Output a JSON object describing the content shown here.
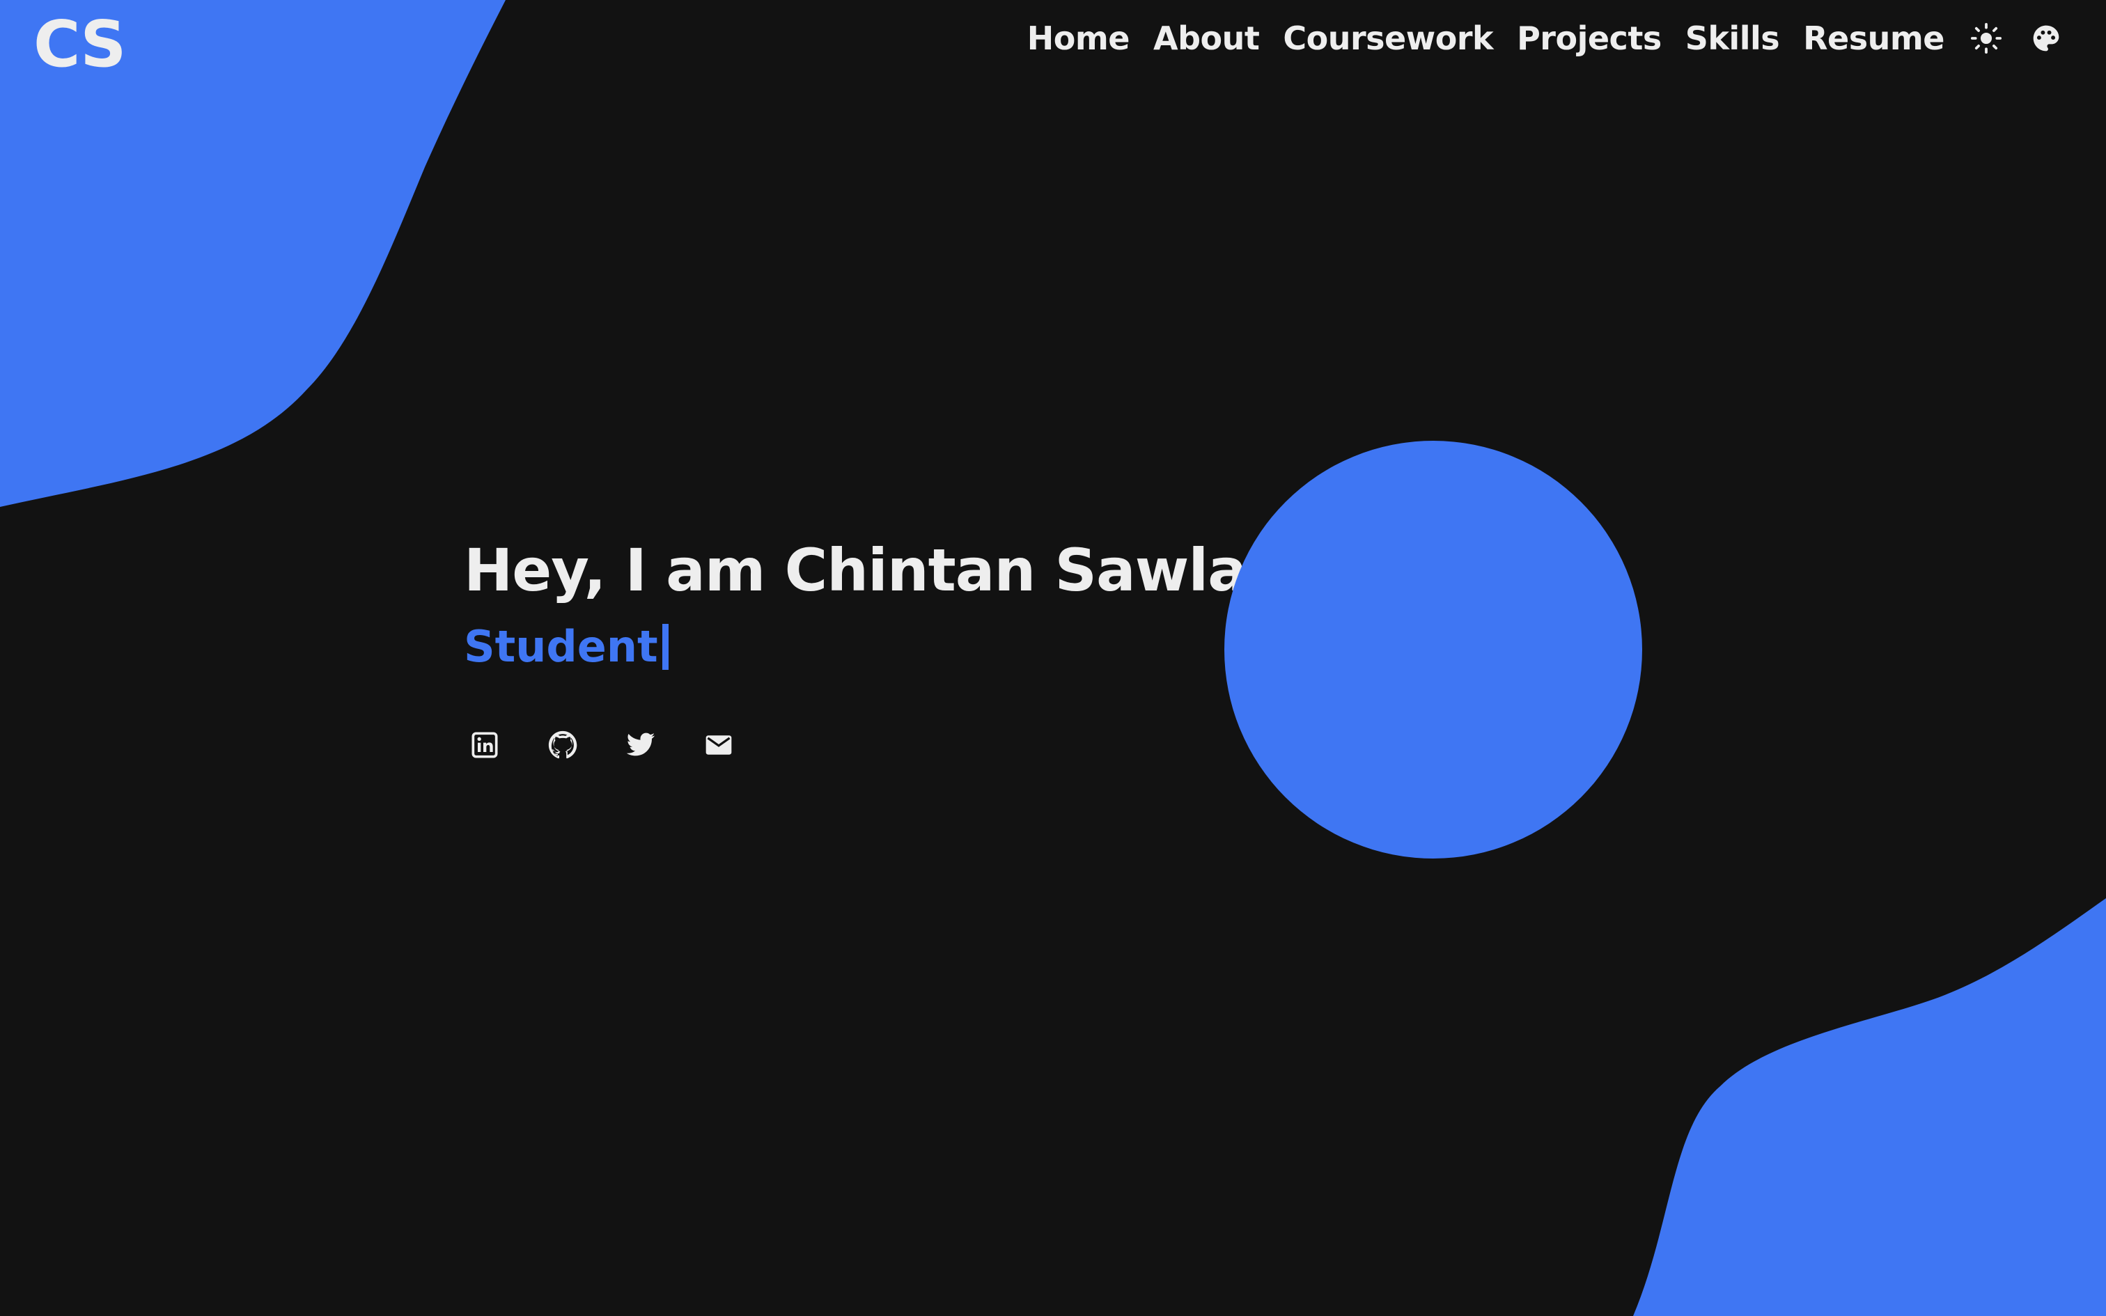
{
  "colors": {
    "background": "#121212",
    "accent": "#3f76f3",
    "text": "#eeeeee"
  },
  "brand": {
    "logo_text": "CS"
  },
  "nav": {
    "items": [
      {
        "label": "Home"
      },
      {
        "label": "About"
      },
      {
        "label": "Coursework"
      },
      {
        "label": "Projects"
      },
      {
        "label": "Skills"
      },
      {
        "label": "Resume"
      }
    ],
    "icons": [
      "sun-icon",
      "palette-icon"
    ]
  },
  "hero": {
    "title": "Hey, I am Chintan Sawla",
    "typed_text": "Student"
  },
  "socials": [
    "linkedin-icon",
    "github-icon",
    "twitter-icon",
    "email-icon"
  ]
}
